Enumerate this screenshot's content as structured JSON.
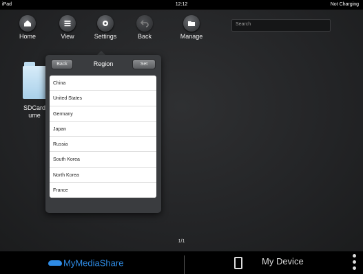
{
  "statusbar": {
    "device": "iPad",
    "time": "12:12",
    "battery": "Not Charging"
  },
  "toolbar": {
    "home": "Home",
    "view": "View",
    "settings": "Settings",
    "back": "Back",
    "manage": "Manage"
  },
  "search": {
    "placeholder": "Search"
  },
  "files": [
    {
      "name": "SDCard ume"
    }
  ],
  "popover": {
    "title": "Region",
    "back_label": "Back",
    "set_label": "Set",
    "regions": [
      "China",
      "United States",
      "Germany",
      "Japan",
      "Russia",
      "South Korea",
      "North Korea",
      "France"
    ]
  },
  "pagination": "1/1",
  "bottombar": {
    "app_name": "MyMediaShare",
    "device_label": "My Device"
  },
  "colors": {
    "accent": "#2f8ce6"
  }
}
